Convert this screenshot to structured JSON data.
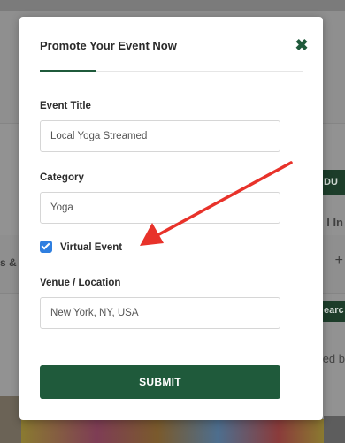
{
  "modal": {
    "title": "Promote Your Event Now",
    "close_icon": "close-icon",
    "fields": {
      "event_title": {
        "label": "Event Title",
        "value": "Local Yoga Streamed"
      },
      "category": {
        "label": "Category",
        "value": "Yoga"
      },
      "venue": {
        "label": "Venue / Location",
        "value": "New York, NY, USA"
      }
    },
    "virtual_event": {
      "label": "Virtual Event",
      "checked": true
    },
    "submit_label": "SUBMIT"
  },
  "background": {
    "left_text": "s &",
    "right_button_1": "DU",
    "right_text_in": "l In",
    "right_plus": "+",
    "right_button_2": "earc",
    "right_text_ed": "ed b"
  },
  "colors": {
    "accent": "#1f5a3b",
    "checkbox": "#2f7fe0",
    "annotation_arrow": "#e8322a"
  }
}
